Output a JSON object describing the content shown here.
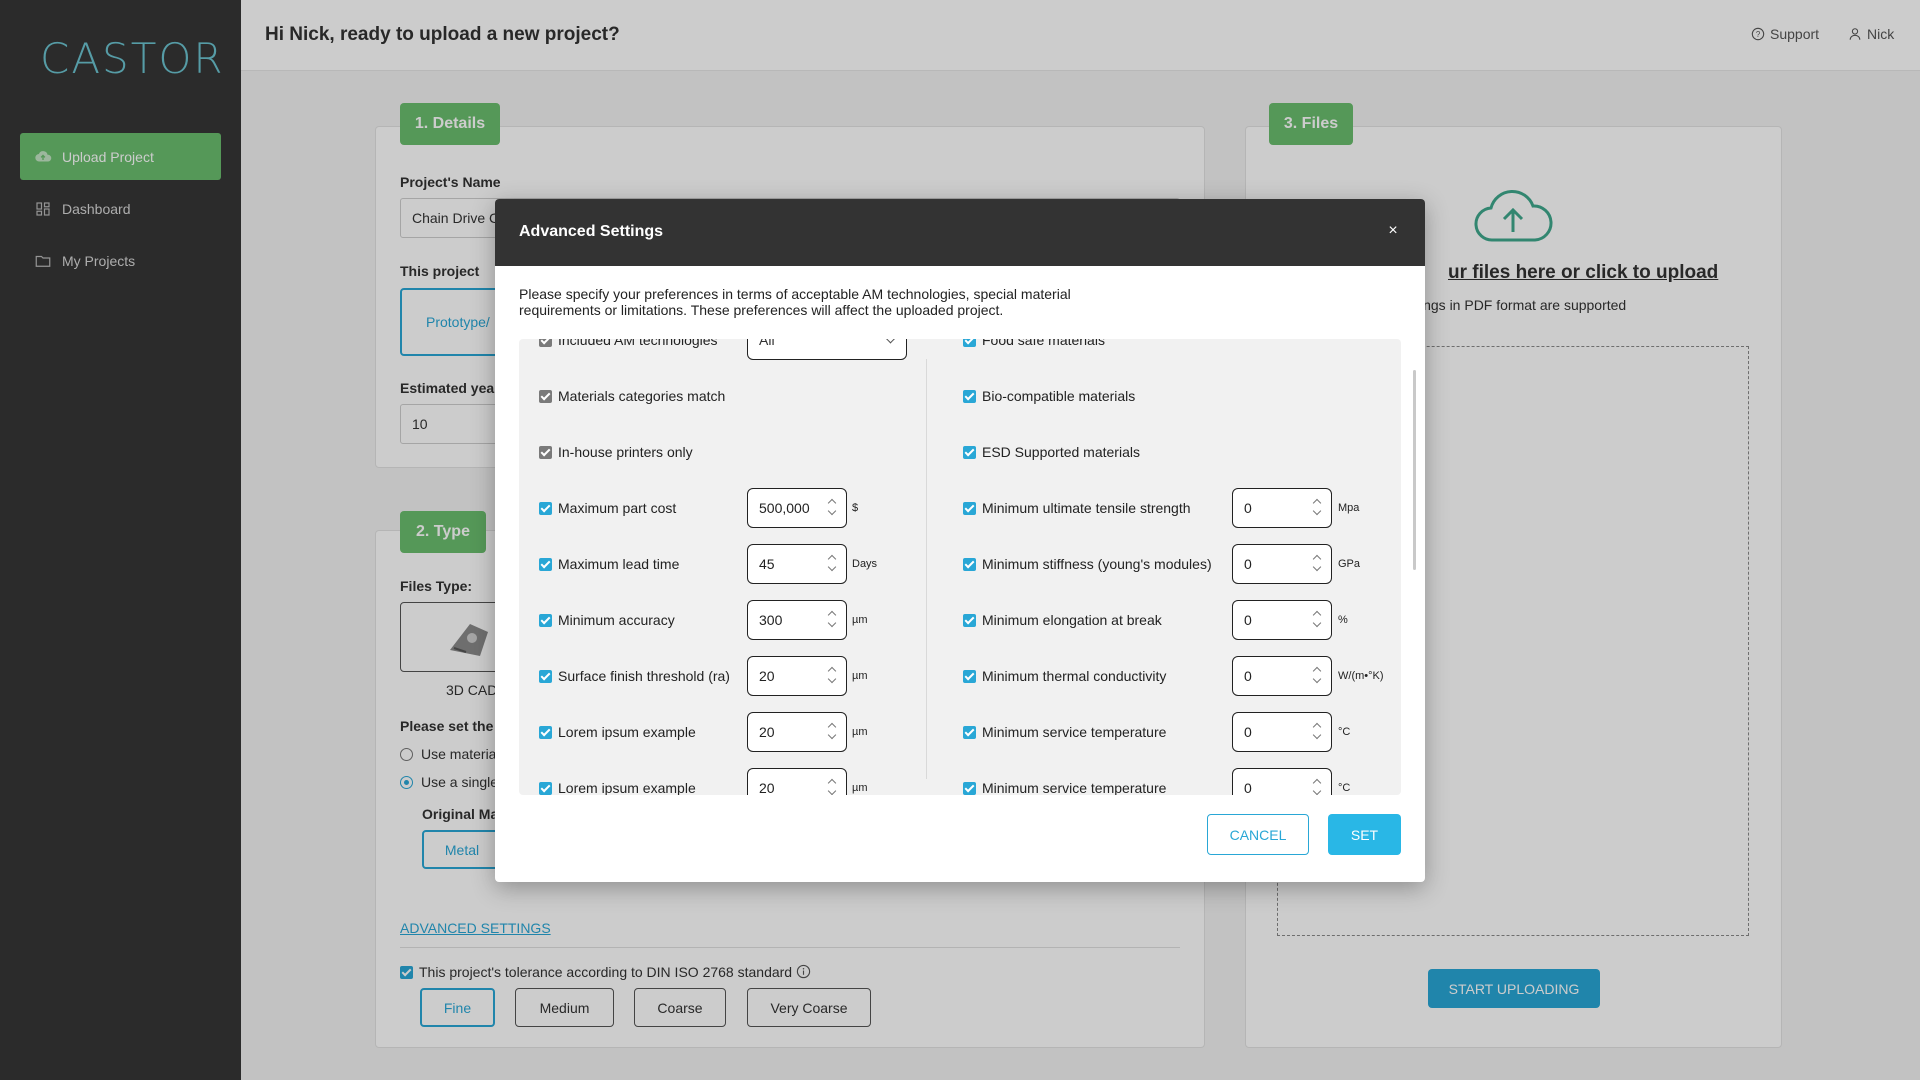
{
  "app": {
    "logo": "CASTOR"
  },
  "sidebar": {
    "items": [
      {
        "label": "Upload Project",
        "icon": "cloud-upload-icon"
      },
      {
        "label": "Dashboard",
        "icon": "grid-icon"
      },
      {
        "label": "My Projects",
        "icon": "folder-icon"
      }
    ]
  },
  "header": {
    "greeting": "Hi Nick, ready to upload a new project?",
    "support": "Support",
    "user": "Nick"
  },
  "details": {
    "badge": "1. Details",
    "project_name_label": "Project's Name",
    "project_name_value": "Chain Drive C",
    "purpose_label": "This project",
    "purpose_value": "Prototype/",
    "yearly_label": "Estimated yearl",
    "yearly_value": "10"
  },
  "type": {
    "badge": "2. Type",
    "files_type_label": "Files Type:",
    "cad_label": "3D CAD",
    "set_label": "Please set the r",
    "radio_1": "Use materia",
    "radio_2": "Use a single",
    "original_label": "Original Ma",
    "metal": "Metal",
    "advanced_link": "ADVANCED SETTINGS",
    "tolerance_label": "This project's tolerance according to DIN ISO 2768 standard",
    "tolerances": [
      "Fine",
      "Medium",
      "Coarse",
      "Very Coarse"
    ]
  },
  "files": {
    "badge": "3. Files",
    "drop_title": "ur files here or click to upload",
    "drop_sub": "ings in PDF format are supported",
    "start": "START UPLOADING"
  },
  "modal": {
    "title": "Advanced Settings",
    "close": "×",
    "description": "Please specify your preferences in terms of acceptable AM technologies, special material requirements or limitations. These preferences will affect the uploaded project.",
    "left": [
      {
        "label": "Included AM technologies",
        "select": "All"
      },
      {
        "label": "Materials categories match"
      },
      {
        "label": "In-house printers only"
      },
      {
        "label": "Maximum part cost",
        "value": "500,000",
        "unit": "$"
      },
      {
        "label": "Maximum lead time",
        "value": "45",
        "unit": "Days"
      },
      {
        "label": "Minimum accuracy",
        "value": "300",
        "unit": "µm"
      },
      {
        "label": "Surface finish threshold (ra)",
        "value": "20",
        "unit": "µm"
      },
      {
        "label": "Lorem ipsum example",
        "value": "20",
        "unit": "µm"
      },
      {
        "label": "Lorem ipsum example",
        "value": "20",
        "unit": "µm"
      }
    ],
    "right": [
      {
        "label": "Food safe materials"
      },
      {
        "label": "Bio-compatible materials"
      },
      {
        "label": "ESD Supported materials"
      },
      {
        "label": "Minimum ultimate tensile strength",
        "value": "0",
        "unit": "Mpa"
      },
      {
        "label": "Minimum stiffness (young's modules)",
        "value": "0",
        "unit": "GPa"
      },
      {
        "label": "Minimum elongation at break",
        "value": "0",
        "unit": "%"
      },
      {
        "label": "Minimum thermal conductivity",
        "value": "0",
        "unit": "W/(m•°K)"
      },
      {
        "label": "Minimum service temperature",
        "value": "0",
        "unit": "°C"
      },
      {
        "label": "Minimum service temperature",
        "value": "0",
        "unit": "°C"
      }
    ],
    "cancel": "CANCEL",
    "set": "SET"
  },
  "colors": {
    "accent": "#29a7d6",
    "green": "#6bbf6e",
    "sidebar": "#363636",
    "modal_header": "#333333"
  }
}
